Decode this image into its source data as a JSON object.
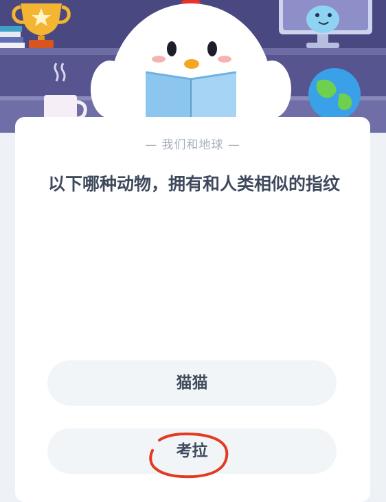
{
  "category": "— 我们和地球 —",
  "question": "以下哪种动物，拥有和人类相似的指纹",
  "options": [
    {
      "label": "猫猫"
    },
    {
      "label": "考拉"
    }
  ],
  "colors": {
    "banner": "#4f4d86",
    "card": "#ffffff",
    "question_text": "#3e4a5c",
    "option_bg": "#f1f5f7",
    "annotation": "#e23b22"
  }
}
